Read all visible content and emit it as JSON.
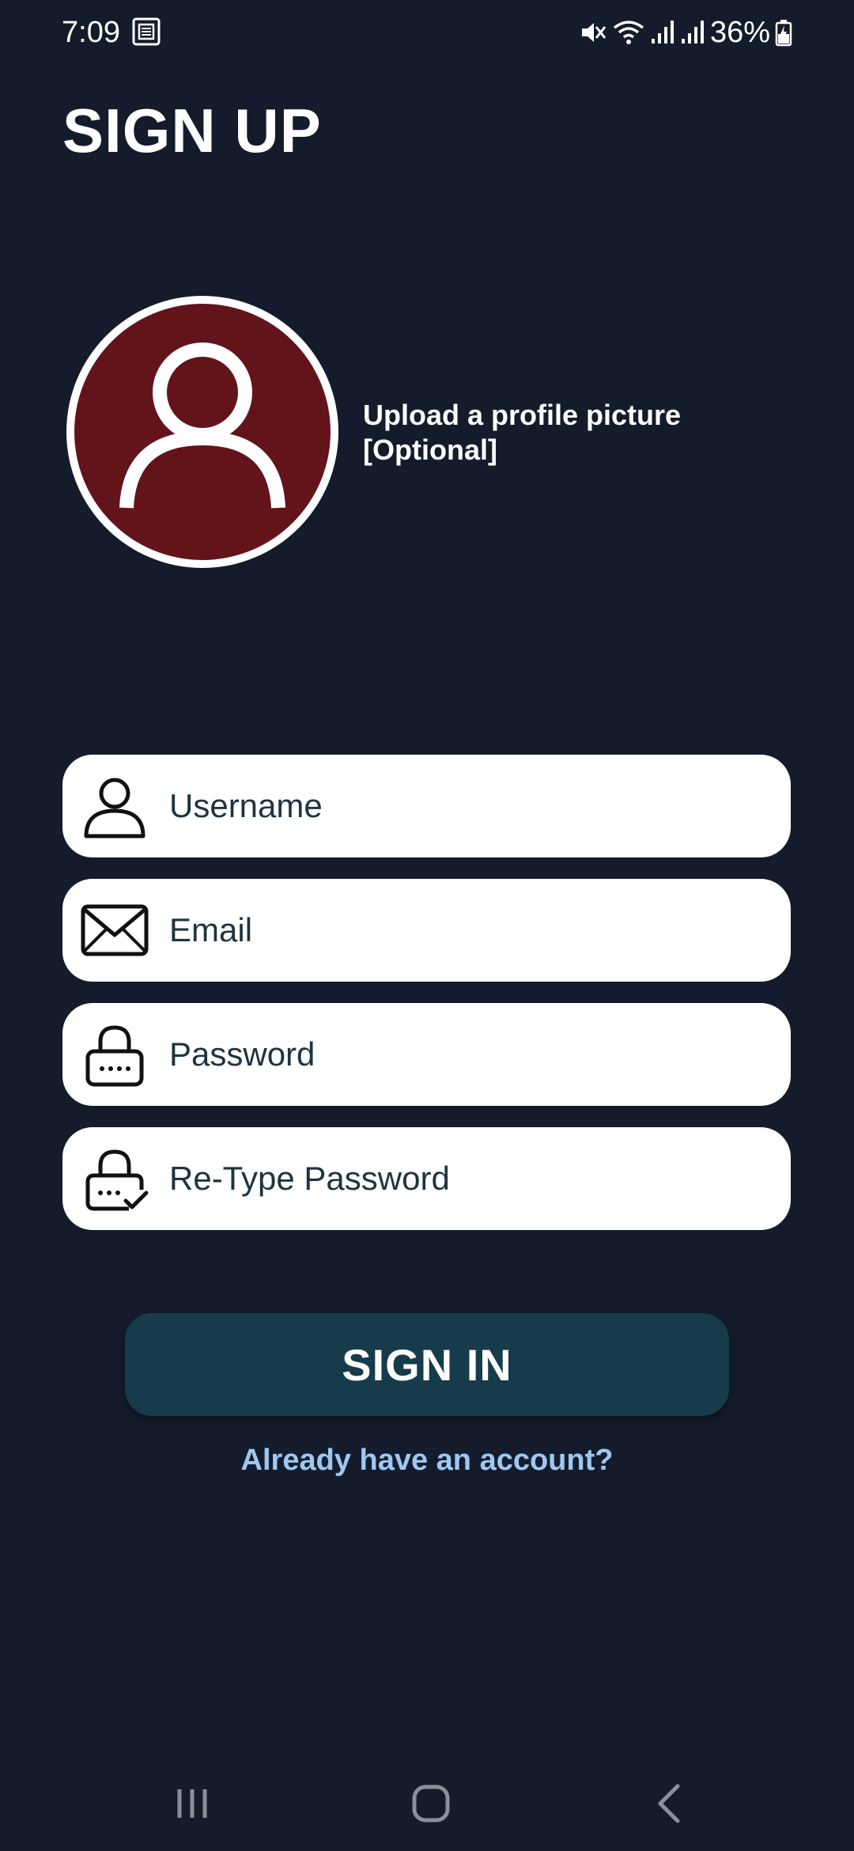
{
  "status_bar": {
    "time": "7:09",
    "battery": "36%",
    "icons": [
      "notification-icon",
      "mute-icon",
      "wifi-icon",
      "signal-icon",
      "signal-icon",
      "battery-charging-icon"
    ]
  },
  "page": {
    "title": "SIGN UP"
  },
  "profile": {
    "upload_line1": "Upload a profile picture",
    "upload_line2": "[Optional]",
    "avatar_color": "#63141b"
  },
  "form": {
    "fields": [
      {
        "placeholder": "Username",
        "icon": "user-icon",
        "value": ""
      },
      {
        "placeholder": "Email",
        "icon": "envelope-icon",
        "value": ""
      },
      {
        "placeholder": "Password",
        "icon": "lock-icon",
        "value": ""
      },
      {
        "placeholder": "Re-Type Password",
        "icon": "lock-check-icon",
        "value": ""
      }
    ],
    "submit_label": "SIGN IN",
    "account_link": "Already have an account?"
  },
  "colors": {
    "background": "#141c2b",
    "button": "#163b4a",
    "link": "#9ec8f2",
    "field_text": "#1e3440"
  },
  "nav_bar": {
    "icons": [
      "recent-apps-icon",
      "home-icon",
      "back-icon"
    ]
  }
}
